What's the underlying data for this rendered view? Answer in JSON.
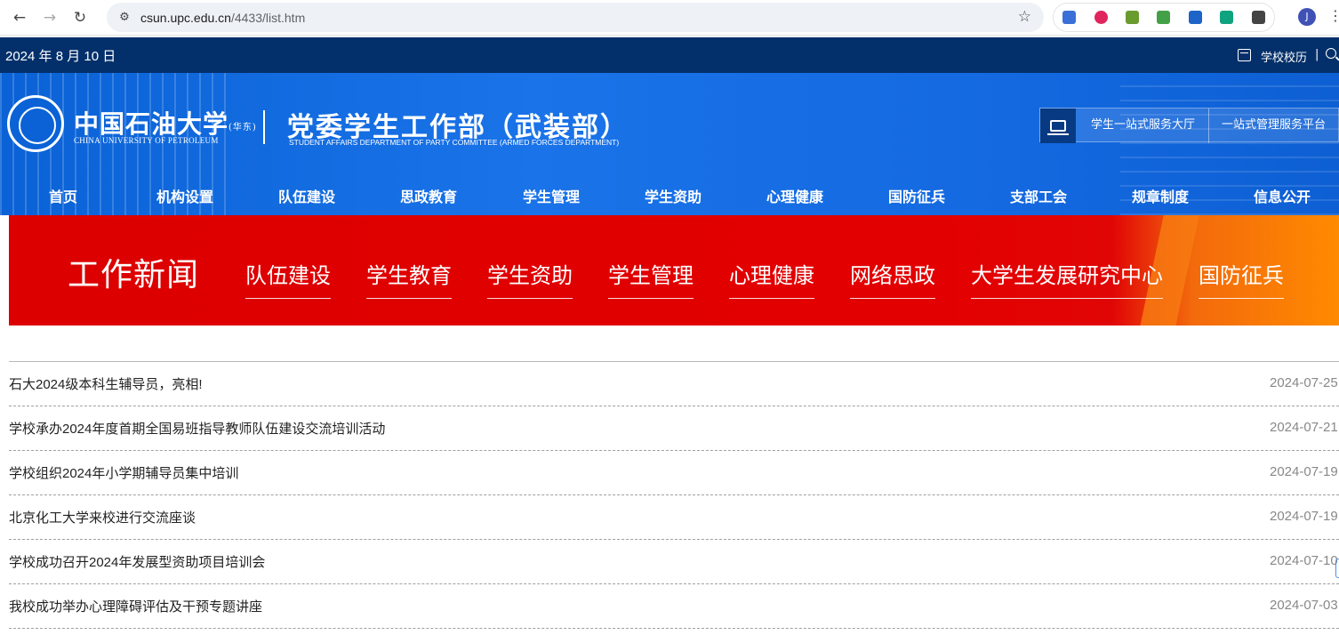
{
  "browser": {
    "url_host": "csun.upc.edu.cn",
    "url_path": "/4433/list.htm",
    "profile_initial": "J",
    "extensions": [
      {
        "name": "grid-extension-icon",
        "color": "#3b6fd8"
      },
      {
        "name": "red-extension-icon",
        "color": "#e0245e"
      },
      {
        "name": "bicycle-extension-icon",
        "color": "#6a9b2e"
      },
      {
        "name": "plus-extension-icon",
        "color": "#43a047"
      },
      {
        "name": "mortarboard-extension-icon",
        "color": "#1e64c8"
      },
      {
        "name": "openai-extension-icon",
        "color": "#10a37f"
      },
      {
        "name": "puzzle-extension-icon",
        "color": "#444444"
      }
    ]
  },
  "topbar": {
    "date": "2024 年 8 月 10 日",
    "calendar_link": "学校校历",
    "separator": "|"
  },
  "header": {
    "uni_cn": "中国石油大学",
    "uni_cn_suffix": "(华东)",
    "uni_en": "CHINA UNIVERSITY OF PETROLEUM",
    "dept_cn": "党委学生工作部（武装部）",
    "dept_en": "STUDENT AFFAIRS DEPARTMENT OF PARTY COMMITTEE (ARMED FORCES DEPARTMENT)",
    "services": [
      "学生一站式服务大厅",
      "一站式管理服务平台"
    ]
  },
  "nav": [
    "首页",
    "机构设置",
    "队伍建设",
    "思政教育",
    "学生管理",
    "学生资助",
    "心理健康",
    "国防征兵",
    "支部工会",
    "规章制度",
    "信息公开"
  ],
  "section": {
    "title": "工作新闻",
    "tabs": [
      "队伍建设",
      "学生教育",
      "学生资助",
      "学生管理",
      "心理健康",
      "网络思政",
      "大学生发展研究中心",
      "国防征兵"
    ]
  },
  "news": [
    {
      "title": "石大2024级本科生辅导员，亮相!",
      "date": "2024-07-25"
    },
    {
      "title": "学校承办2024年度首期全国易班指导教师队伍建设交流培训活动",
      "date": "2024-07-21"
    },
    {
      "title": "学校组织2024年小学期辅导员集中培训",
      "date": "2024-07-19"
    },
    {
      "title": "北京化工大学来校进行交流座谈",
      "date": "2024-07-19"
    },
    {
      "title": "学校成功召开2024年发展型资助项目培训会",
      "date": "2024-07-10"
    },
    {
      "title": "我校成功举办心理障碍评估及干预专题讲座",
      "date": "2024-07-03"
    }
  ],
  "colors": {
    "topbar": "#03306a",
    "banner": "#1a73e8",
    "section_band": "#e30000"
  }
}
